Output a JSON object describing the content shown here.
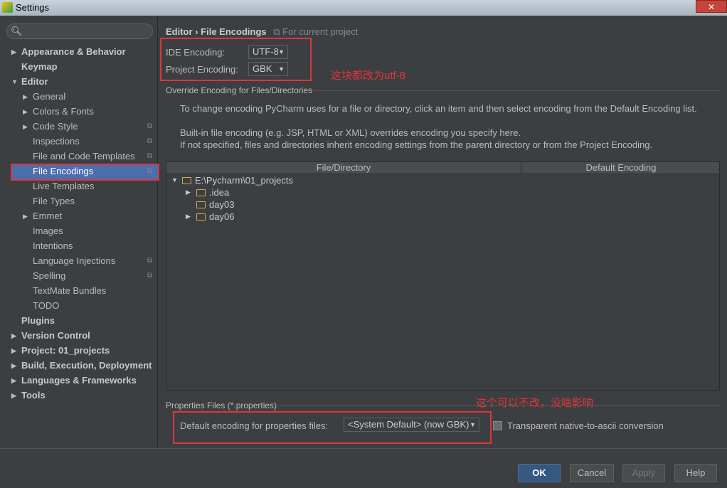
{
  "window": {
    "title": "Settings",
    "close": "✕"
  },
  "sidebar": {
    "search_placeholder": "",
    "items": [
      {
        "label": "Appearance & Behavior",
        "level": 0,
        "arrow": "▶"
      },
      {
        "label": "Keymap",
        "level": 0
      },
      {
        "label": "Editor",
        "level": 0,
        "arrow": "▼"
      },
      {
        "label": "General",
        "level": 1,
        "arrow": "▶"
      },
      {
        "label": "Colors & Fonts",
        "level": 1,
        "arrow": "▶"
      },
      {
        "label": "Code Style",
        "level": 1,
        "arrow": "▶",
        "project": true
      },
      {
        "label": "Inspections",
        "level": 1,
        "project": true
      },
      {
        "label": "File and Code Templates",
        "level": 1,
        "project": true
      },
      {
        "label": "File Encodings",
        "level": 1,
        "project": true,
        "selected": true
      },
      {
        "label": "Live Templates",
        "level": 1
      },
      {
        "label": "File Types",
        "level": 1
      },
      {
        "label": "Emmet",
        "level": 1,
        "arrow": "▶"
      },
      {
        "label": "Images",
        "level": 1
      },
      {
        "label": "Intentions",
        "level": 1
      },
      {
        "label": "Language Injections",
        "level": 1,
        "project": true
      },
      {
        "label": "Spelling",
        "level": 1,
        "project": true
      },
      {
        "label": "TextMate Bundles",
        "level": 1
      },
      {
        "label": "TODO",
        "level": 1
      },
      {
        "label": "Plugins",
        "level": 0
      },
      {
        "label": "Version Control",
        "level": 0,
        "arrow": "▶"
      },
      {
        "label": "Project: 01_projects",
        "level": 0,
        "arrow": "▶"
      },
      {
        "label": "Build, Execution, Deployment",
        "level": 0,
        "arrow": "▶"
      },
      {
        "label": "Languages & Frameworks",
        "level": 0,
        "arrow": "▶"
      },
      {
        "label": "Tools",
        "level": 0,
        "arrow": "▶"
      }
    ]
  },
  "main": {
    "breadcrumb": {
      "parent": "Editor",
      "sep": "›",
      "current": "File Encodings",
      "scope": "For current project"
    },
    "ide_encoding": {
      "label": "IDE Encoding:",
      "value": "UTF-8"
    },
    "project_encoding": {
      "label": "Project Encoding:",
      "value": "GBK"
    },
    "annotation1": "这块都改为utf-8",
    "override_group": "Override Encoding for Files/Directories",
    "help1": "To change encoding PyCharm uses for a file or directory, click an item and then select encoding from the Default Encoding list.",
    "help2": "Built-in file encoding (e.g. JSP, HTML or XML) overrides encoding you specify here.",
    "help3": "If not specified, files and directories inherit encoding settings from the parent directory or from the Project Encoding.",
    "table": {
      "columns": [
        "File/Directory",
        "Default Encoding"
      ],
      "rows": [
        {
          "name": "E:\\Pycharm\\01_projects",
          "arrow": "▼",
          "depth": 0
        },
        {
          "name": ".idea",
          "arrow": "▶",
          "depth": 1
        },
        {
          "name": "day03",
          "arrow": "",
          "depth": 1
        },
        {
          "name": "day06",
          "arrow": "▶",
          "depth": 1
        }
      ]
    },
    "properties_group": "Properties Files (*.properties)",
    "annotation2": "这个可以不改，没啥影响",
    "properties_default": {
      "label": "Default encoding for properties files:",
      "value": "<System Default> (now GBK)"
    },
    "transparent_checkbox": {
      "label": "Transparent native-to-ascii conversion",
      "checked": false
    }
  },
  "footer": {
    "ok": "OK",
    "cancel": "Cancel",
    "apply": "Apply",
    "help": "Help"
  },
  "colors": {
    "accent": "#4b6eaf",
    "annotation": "#e0353a",
    "background": "#3c3f41"
  }
}
